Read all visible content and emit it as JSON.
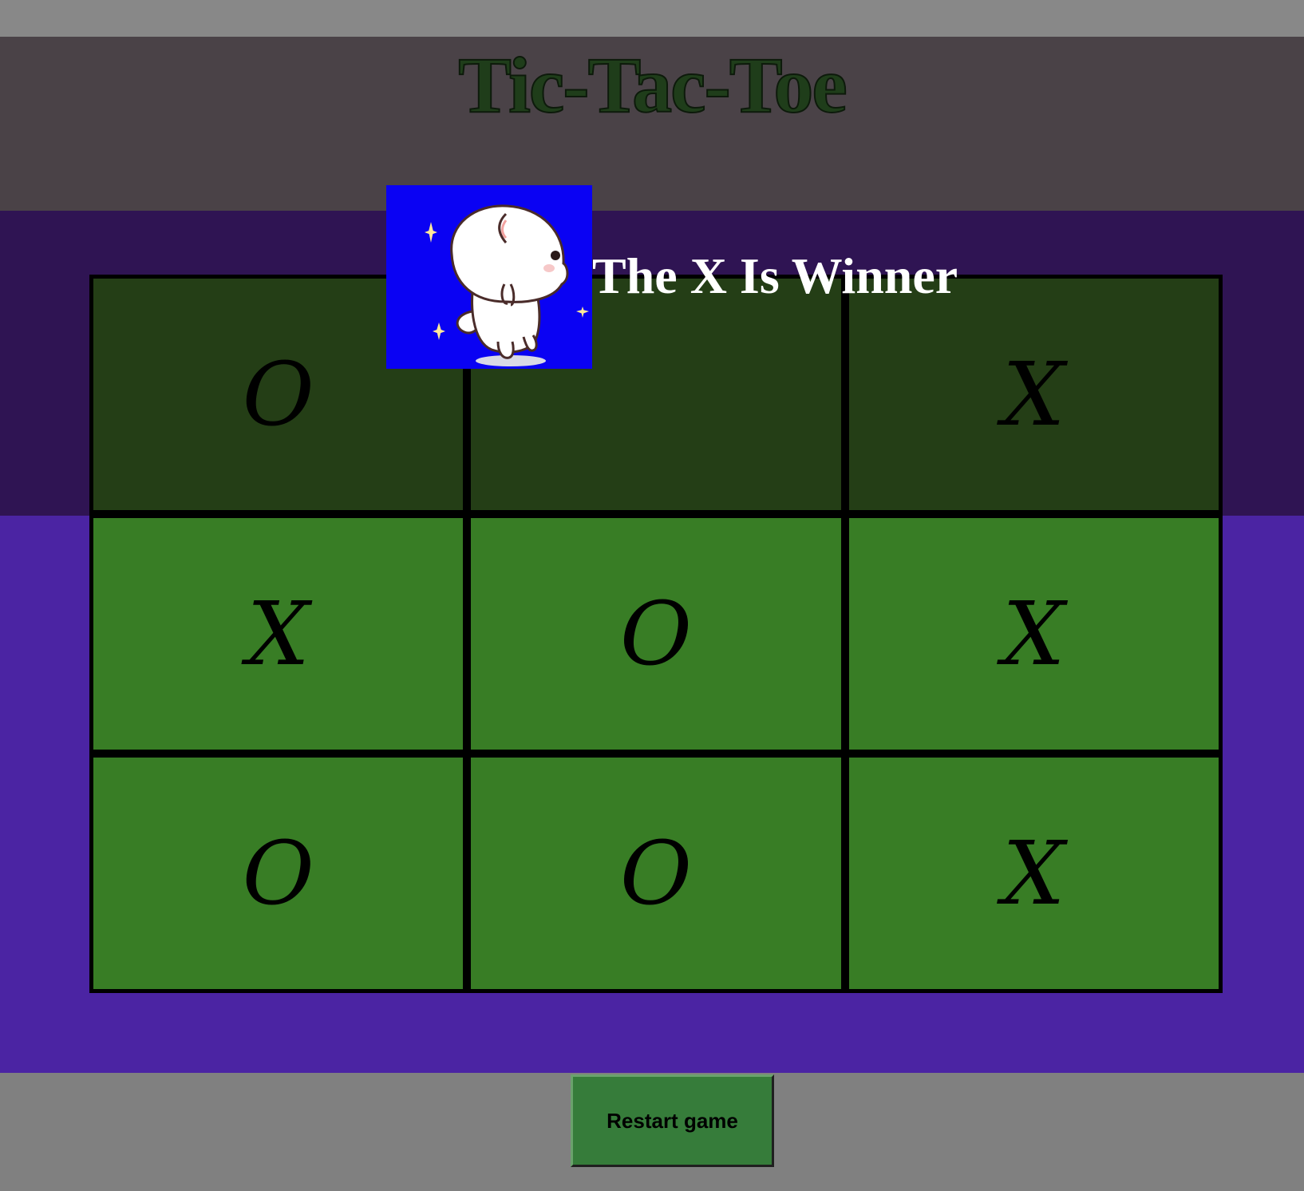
{
  "header": {
    "title": "Tic-Tac-Toe"
  },
  "status": {
    "winner_text": "The X Is Winner"
  },
  "board": {
    "cells": [
      "O",
      "",
      "X",
      "X",
      "O",
      "X",
      "O",
      "O",
      "X"
    ]
  },
  "controls": {
    "restart_label": "Restart game"
  },
  "colors": {
    "header_bg": "#4a4247",
    "band_dark": "#2f1453",
    "band_light": "#4b24a3",
    "cell_active": "#387d25",
    "cell_dim": "#243e16",
    "button_bg": "#367c3a",
    "page_bg": "#808080"
  }
}
